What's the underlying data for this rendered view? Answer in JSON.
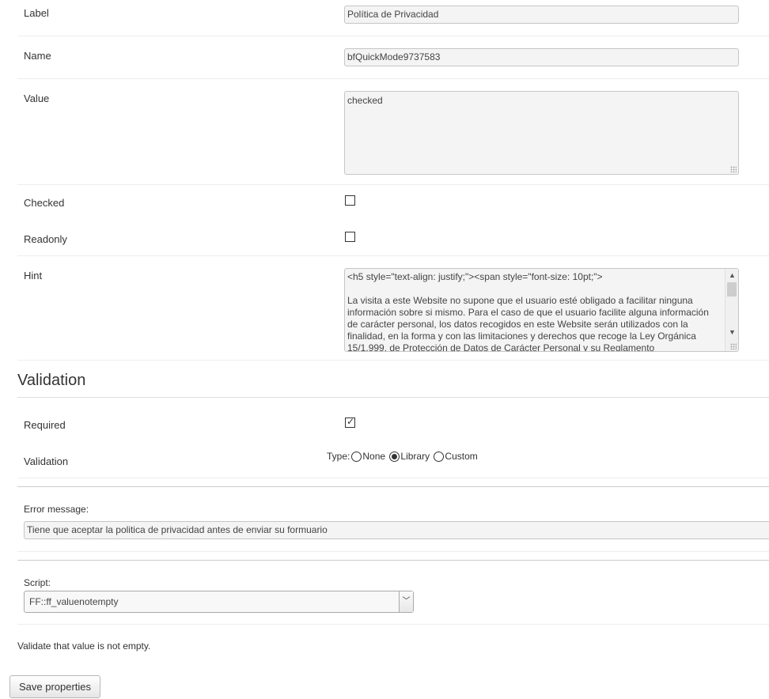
{
  "properties": {
    "label": {
      "label": "Label",
      "value": "Política de Privacidad"
    },
    "name": {
      "label": "Name",
      "value": "bfQuickMode9737583"
    },
    "value": {
      "label": "Value",
      "value": "checked"
    },
    "checked": {
      "label": "Checked",
      "is_checked": false
    },
    "readonly": {
      "label": "Readonly",
      "is_checked": false
    },
    "hint": {
      "label": "Hint",
      "line1": "<h5 style=\"text-align: justify;\"><span style=\"font-size: 10pt;\">",
      "para": "La visita a este Website no supone que el usuario esté obligado a facilitar ninguna información sobre si mismo. Para el caso de que el usuario facilite alguna información de carácter personal, los datos recogidos en este Website serán utilizados con la finalidad, en la forma y con las limitaciones y derechos que recoge la Ley Orgánica 15/1.999, de Protección de Datos de Carácter Personal y su Reglamento"
    }
  },
  "validation": {
    "heading": "Validation",
    "required": {
      "label": "Required",
      "is_checked": true
    },
    "type": {
      "label": "Validation",
      "prefix": "Type:",
      "options": [
        "None",
        "Library",
        "Custom"
      ],
      "selected": "Library"
    },
    "error_message": {
      "label": "Error message:",
      "value": "Tiene que aceptar la politica de privacidad antes de enviar su formuario"
    },
    "script": {
      "label": "Script:",
      "selected": "FF::ff_valuenotempty"
    },
    "description": "Validate that value is not empty."
  },
  "actions": {
    "save_label": "Save properties"
  }
}
